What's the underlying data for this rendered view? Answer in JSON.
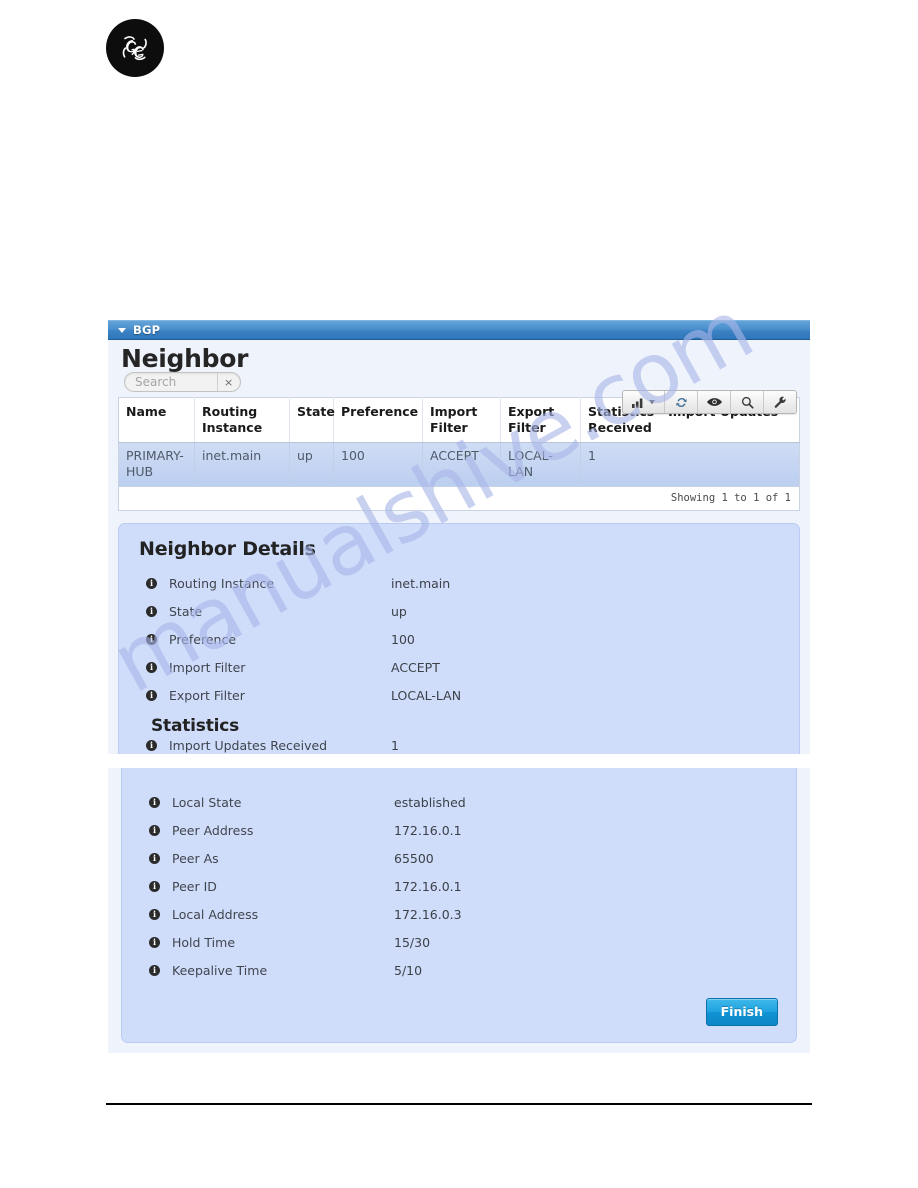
{
  "brand": {
    "logo_name": "GE",
    "logo_alt": "GE monogram logo"
  },
  "watermark": {
    "text": "manualshive.com"
  },
  "window": {
    "title": "BGP",
    "collapse_icon": "caret-down-icon"
  },
  "list": {
    "title": "Neighbor",
    "search": {
      "value": "",
      "placeholder": "Search",
      "clear_label": "×"
    },
    "toolbar": [
      {
        "name": "chart-menu-button",
        "icon": "bar-chart-icon",
        "has_caret": true
      },
      {
        "name": "refresh-button",
        "icon": "refresh-icon",
        "has_caret": false
      },
      {
        "name": "view-button",
        "icon": "eye-icon",
        "has_caret": false
      },
      {
        "name": "search-button",
        "icon": "magnifier-icon",
        "has_caret": false
      },
      {
        "name": "settings-button",
        "icon": "wrench-icon",
        "has_caret": false
      }
    ],
    "columns": [
      "Name",
      "Routing Instance",
      "State",
      "Preference",
      "Import Filter",
      "Export Filter",
      "Statistics - Import Updates Received"
    ],
    "rows": [
      {
        "name": "PRIMARY-HUB",
        "routing_instance": "inet.main",
        "state": "up",
        "preference": "100",
        "import_filter": "ACCEPT",
        "export_filter": "LOCAL-LAN",
        "statistics_import_updates_received": "1"
      }
    ],
    "footer": "Showing 1 to 1 of 1"
  },
  "details": {
    "title": "Neighbor Details",
    "fields": [
      {
        "label": "Routing Instance",
        "value": "inet.main"
      },
      {
        "label": "State",
        "value": "up"
      },
      {
        "label": "Preference",
        "value": "100"
      },
      {
        "label": "Import Filter",
        "value": "ACCEPT"
      },
      {
        "label": "Export Filter",
        "value": "LOCAL-LAN"
      }
    ],
    "statistics": {
      "title": "Statistics",
      "fields": [
        {
          "label": "Import Updates Received",
          "value": "1"
        }
      ]
    },
    "continued_fields": [
      {
        "label": "Local State",
        "value": "established"
      },
      {
        "label": "Peer Address",
        "value": "172.16.0.1"
      },
      {
        "label": "Peer As",
        "value": "65500"
      },
      {
        "label": "Peer ID",
        "value": "172.16.0.1"
      },
      {
        "label": "Local Address",
        "value": "172.16.0.3"
      },
      {
        "label": "Hold Time",
        "value": "15/30"
      },
      {
        "label": "Keepalive Time",
        "value": "5/10"
      }
    ]
  },
  "actions": {
    "finish_label": "Finish"
  },
  "colors": {
    "title_bar_blue": "#3b82c4",
    "panel_bg": "#eef3fc",
    "details_bg": "#cfddfb",
    "row_selected": "#c6d6f2",
    "finish_blue": "#1fa3e0",
    "watermark": "#a9b6e8"
  }
}
